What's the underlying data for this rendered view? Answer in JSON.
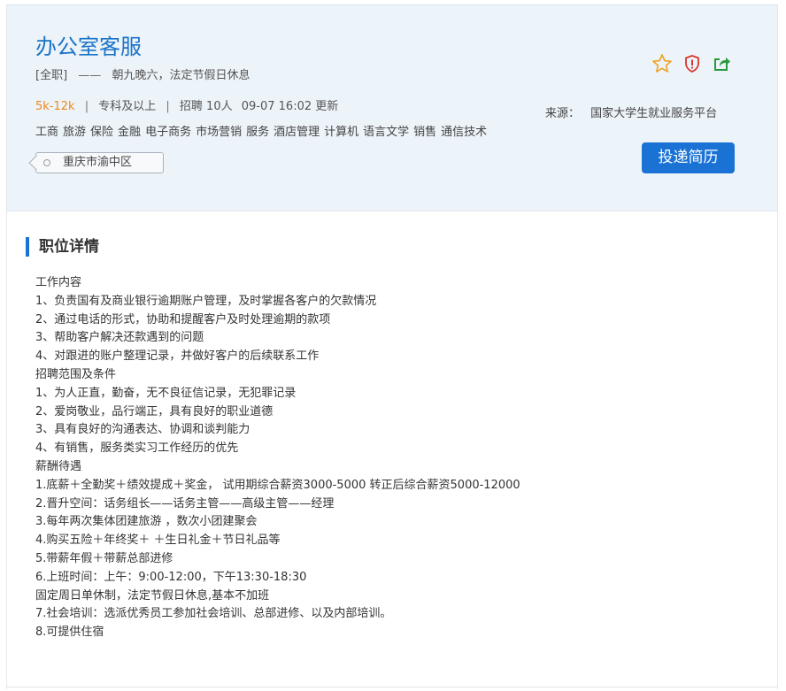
{
  "job": {
    "title": "办公室客服",
    "type": "[全职]",
    "dash": "——",
    "schedule": "朝九晚六，法定节假日休息",
    "salary": "5k-12k",
    "education": "专科及以上",
    "recruit": "招聘 10人",
    "updated": "09-07 16:02 更新",
    "tags": [
      "工商",
      "旅游",
      "保险",
      "金融",
      "电子商务",
      "市场营销",
      "服务",
      "酒店管理",
      "计算机",
      "语言文学",
      "销售",
      "通信技术"
    ],
    "location": "重庆市渝中区"
  },
  "source": {
    "label": "来源：",
    "name": "国家大学生就业服务平台"
  },
  "actions": {
    "apply_label": "投递简历",
    "icons": [
      "star-icon",
      "report-icon",
      "share-icon"
    ]
  },
  "section": {
    "title": "职位详情"
  },
  "details": [
    "工作内容",
    "1、负责国有及商业银行逾期账户管理，及时掌握各客户的欠款情况",
    "2、通过电话的形式，协助和提醒客户及时处理逾期的款项",
    "3、帮助客户解决还款遇到的问题",
    "4、对跟进的账户整理记录，并做好客户的后续联系工作",
    "招聘范围及条件",
    "1、为人正直，勤奋，无不良征信记录，无犯罪记录",
    "2、爱岗敬业，品行端正，具有良好的职业道德",
    "3、具有良好的沟通表达、协调和谈判能力",
    "4、有销售，服务类实习工作经历的优先",
    "薪酬待遇",
    "1.底薪＋全勤奖＋绩效提成＋奖金，   试用期综合薪资3000-5000 转正后综合薪资5000-12000",
    "2.晋升空间：话务组长——话务主管——高级主管——经理",
    "3.每年两次集体团建旅游 ，数次小团建聚会",
    "4.购买五险＋年终奖＋ ＋生日礼金＋节日礼品等",
    "5.带薪年假＋带薪总部进修",
    "6.上班时间：上午：9:00-12:00，下午13:30-18:30",
    "固定周日单休制，法定节假日休息,基本不加班",
    "7.社会培训：选派优秀员工参加社会培训、总部进修、以及内部培训。",
    "8.可提供住宿"
  ],
  "colors": {
    "accent": "#1a73d4",
    "title": "#1a73c9",
    "salary": "#ef8a1a",
    "header_bg": "#ecf3f9"
  }
}
